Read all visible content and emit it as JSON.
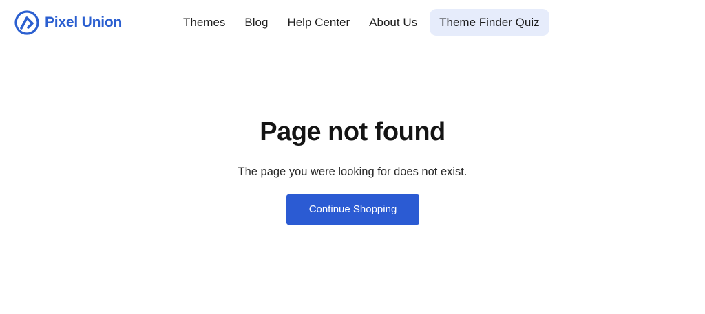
{
  "brand": {
    "name": "Pixel Union",
    "color": "#2b5fd0",
    "logo_icon": "pixel-union-logo-icon"
  },
  "nav": {
    "items": [
      {
        "label": "Themes"
      },
      {
        "label": "Blog"
      },
      {
        "label": "Help Center"
      },
      {
        "label": "About Us"
      },
      {
        "label": "Theme Finder Quiz",
        "highlighted": true,
        "highlight_color": "#e6ecfb"
      }
    ]
  },
  "main": {
    "title": "Page not found",
    "message": "The page you were looking for does not exist.",
    "button_label": "Continue Shopping",
    "button_color": "#2b5bd3"
  }
}
